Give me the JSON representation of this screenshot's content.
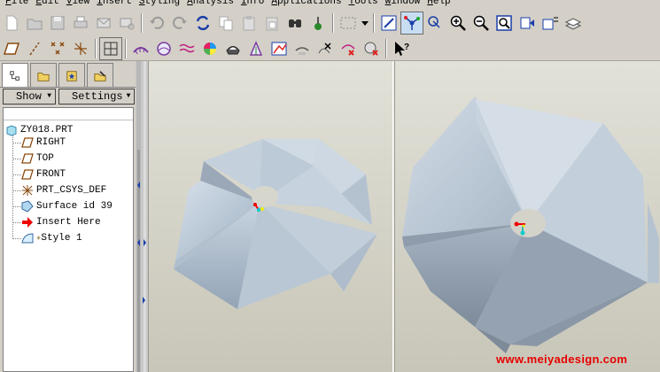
{
  "menu": [
    "File",
    "Edit",
    "View",
    "Insert",
    "Styling",
    "Analysis",
    "Info",
    "Applications",
    "Tools",
    "Window",
    "Help"
  ],
  "toolbar1_icons": [
    "new-icon",
    "open-icon",
    "save-icon",
    "print-icon",
    "email-icon",
    "email-attach-icon",
    "undo-icon",
    "redo-icon",
    "regenerate-icon",
    "copy-icon",
    "paste-icon",
    "paste-special-icon",
    "find-icon",
    "model-tree-icon",
    "select-box-icon",
    "dropdown-icon",
    "repaint-icon",
    "spin-center-icon",
    "datum-display-icon",
    "zoom-in-icon",
    "zoom-out-icon",
    "refit-icon",
    "orient-icon",
    "saved-views-icon",
    "layers-icon"
  ],
  "toolbar2_icons": [
    "datum-plane-display-icon",
    "datum-axis-display-icon",
    "datum-point-display-icon",
    "csys-display-icon",
    "sketcher-grid-icon",
    "curvature-icon",
    "surface-analysis-icon",
    "reflection-icon",
    "shade-icon",
    "draft-icon",
    "dihedral-icon",
    "slope-icon",
    "offset-icon",
    "delete-analysis-icon",
    "delete-all-icon",
    "context-help-icon"
  ],
  "panel": {
    "show_label": "Show",
    "settings_label": "Settings"
  },
  "tree": [
    {
      "label": "ZY018.PRT",
      "icon": "part-icon"
    },
    {
      "label": "RIGHT",
      "icon": "datum-plane-icon"
    },
    {
      "label": "TOP",
      "icon": "datum-plane-icon"
    },
    {
      "label": "FRONT",
      "icon": "datum-plane-icon"
    },
    {
      "label": "PRT_CSYS_DEF",
      "icon": "csys-icon"
    },
    {
      "label": "Surface id 39",
      "icon": "surface-icon"
    },
    {
      "label": "Insert Here",
      "icon": "insert-arrow-icon"
    },
    {
      "label": "Style 1",
      "icon": "style-icon"
    }
  ],
  "watermark": "www.meiyadesign.com",
  "colors": {
    "accent": "#e60000",
    "surface": "#b7c6d6",
    "surface_dark": "#8e9aa8"
  }
}
